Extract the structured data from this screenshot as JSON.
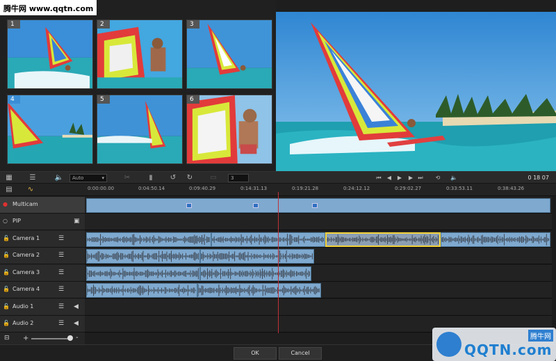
{
  "watermark": {
    "left": "腾牛网 www.qqtn.com",
    "right_brand": "QQTN.com",
    "right_cn": "腾牛网"
  },
  "cameras": [
    {
      "num": "1"
    },
    {
      "num": "2"
    },
    {
      "num": "3"
    },
    {
      "num": "4",
      "selected": true
    },
    {
      "num": "5"
    },
    {
      "num": "6"
    }
  ],
  "toolbar": {
    "grid_icon": "grid-icon",
    "list_icon": "list-icon",
    "volume_icon": "volume-icon",
    "mode_select": "Auto",
    "scissors_icon": "scissors-icon",
    "marker_icon": "marker-icon",
    "rotate_left_icon": "rotate-left-icon",
    "rotate_right_icon": "rotate-right-icon",
    "counter_value": "3",
    "timecode": "0 18 07",
    "timecode_frames": "07"
  },
  "ruler": {
    "labels": [
      "0:00:00.00",
      "0:04:50.14",
      "0:09:40.29",
      "0:14:31.13",
      "0:19:21.28",
      "0:24:12.12",
      "0:29:02.27",
      "0:33:53.11",
      "0:38:43.26"
    ]
  },
  "tracks": [
    {
      "name": "Multicam",
      "icon": "record-dot-icon",
      "kind": "multicam"
    },
    {
      "name": "PIP",
      "icon": "circle-icon",
      "kind": "pip"
    },
    {
      "name": "Camera 1",
      "icon": "lock-icon",
      "kind": "video"
    },
    {
      "name": "Camera 2",
      "icon": "lock-icon",
      "kind": "video"
    },
    {
      "name": "Camera 3",
      "icon": "lock-icon",
      "kind": "video"
    },
    {
      "name": "Camera 4",
      "icon": "lock-icon",
      "kind": "video"
    },
    {
      "name": "Audio 1",
      "icon": "lock-icon",
      "kind": "audio"
    },
    {
      "name": "Audio 2",
      "icon": "lock-icon",
      "kind": "audio"
    }
  ],
  "footer": {
    "ok": "OK",
    "cancel": "Cancel",
    "zoom_minus": "-",
    "zoom_plus": "+"
  },
  "colors": {
    "clip": "#7fa9cf",
    "highlight": "#f3d23a",
    "playhead": "#c0303a",
    "selected_badge": "#3a8ed6"
  }
}
